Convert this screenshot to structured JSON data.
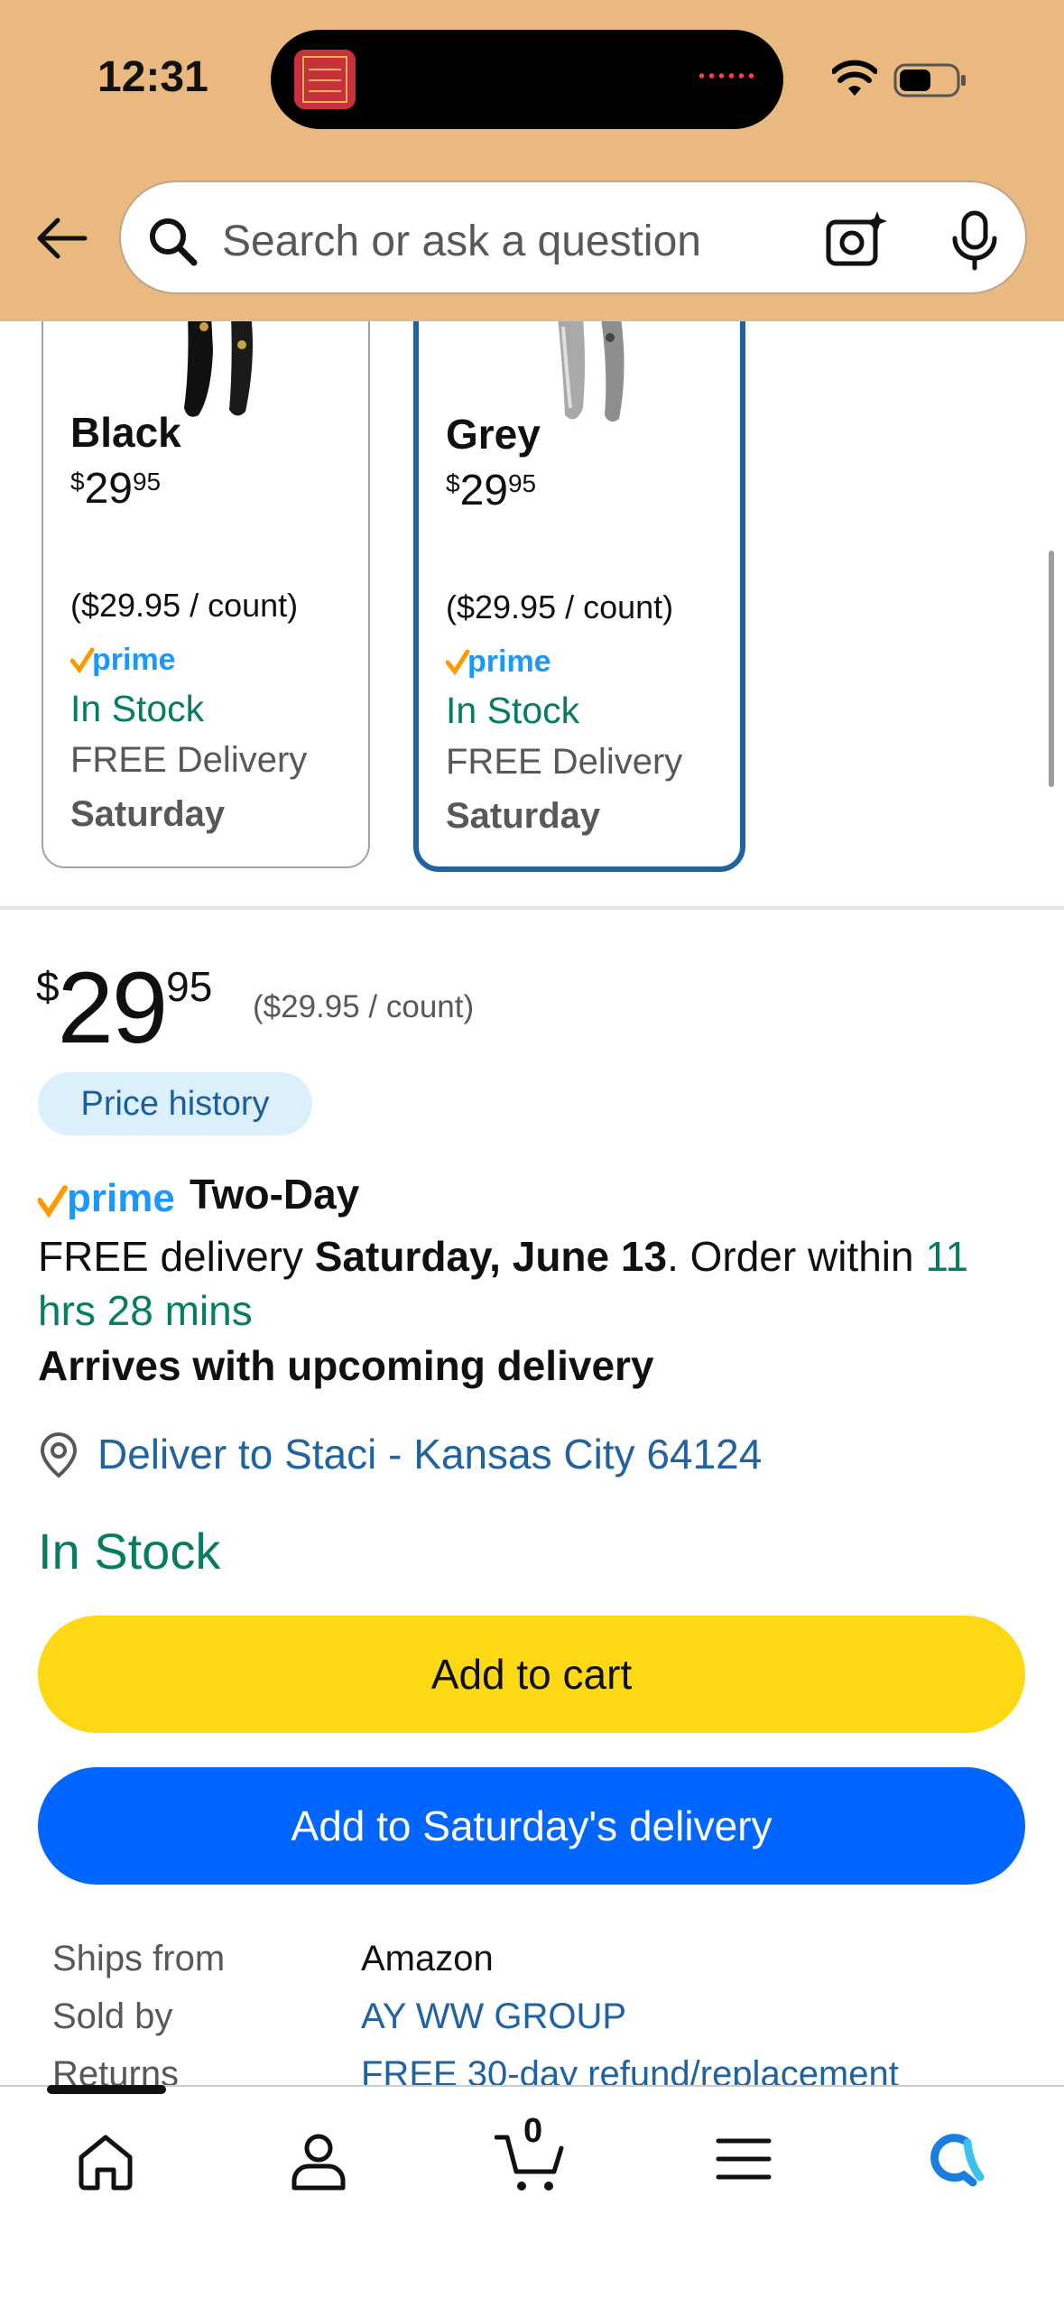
{
  "status_bar": {
    "time": "12:31"
  },
  "search": {
    "placeholder": "Search or ask a question"
  },
  "variants": [
    {
      "name": "Black",
      "price_whole": "29",
      "price_cents": "95",
      "currency": "$",
      "unit_price": "($29.95 / count)",
      "stock": "In Stock",
      "delivery": "FREE Delivery",
      "delivery_day": "Saturday",
      "selected": false
    },
    {
      "name": "Grey",
      "price_whole": "29",
      "price_cents": "95",
      "currency": "$",
      "unit_price": "($29.95 / count)",
      "stock": "In Stock",
      "delivery": "FREE Delivery",
      "delivery_day": "Saturday",
      "selected": true
    }
  ],
  "buybox": {
    "currency": "$",
    "price_whole": "29",
    "price_cents": "95",
    "unit_price": "($29.95 / count)",
    "price_history_label": "Price history",
    "prime_label": "prime",
    "two_day_label": "Two-Day",
    "delivery_prefix": "FREE delivery ",
    "delivery_date": "Saturday, June 13",
    "delivery_middle": ". Order within ",
    "delivery_countdown": "11 hrs 28 mins",
    "upcoming": "Arrives with upcoming delivery",
    "deliver_to": "Deliver to Staci - Kansas City 64124",
    "stock": "In Stock",
    "add_to_cart": "Add to cart",
    "add_to_delivery": "Add to Saturday's delivery"
  },
  "details": [
    {
      "label": "Ships from",
      "value": "Amazon",
      "link": false
    },
    {
      "label": "Sold by",
      "value": "AY WW GROUP",
      "link": true
    },
    {
      "label": "Returns",
      "value": "FREE 30-day refund/replacement",
      "link": true
    }
  ],
  "bottom_nav": {
    "cart_count": "0"
  },
  "colors": {
    "header_bg": "#eab97f",
    "prime_blue": "#1a98ff",
    "prime_check": "#ff9900",
    "stock_green": "#067d62",
    "link_blue": "#2162a1",
    "cart_button": "#ffd814",
    "delivery_button": "#0066ff"
  }
}
